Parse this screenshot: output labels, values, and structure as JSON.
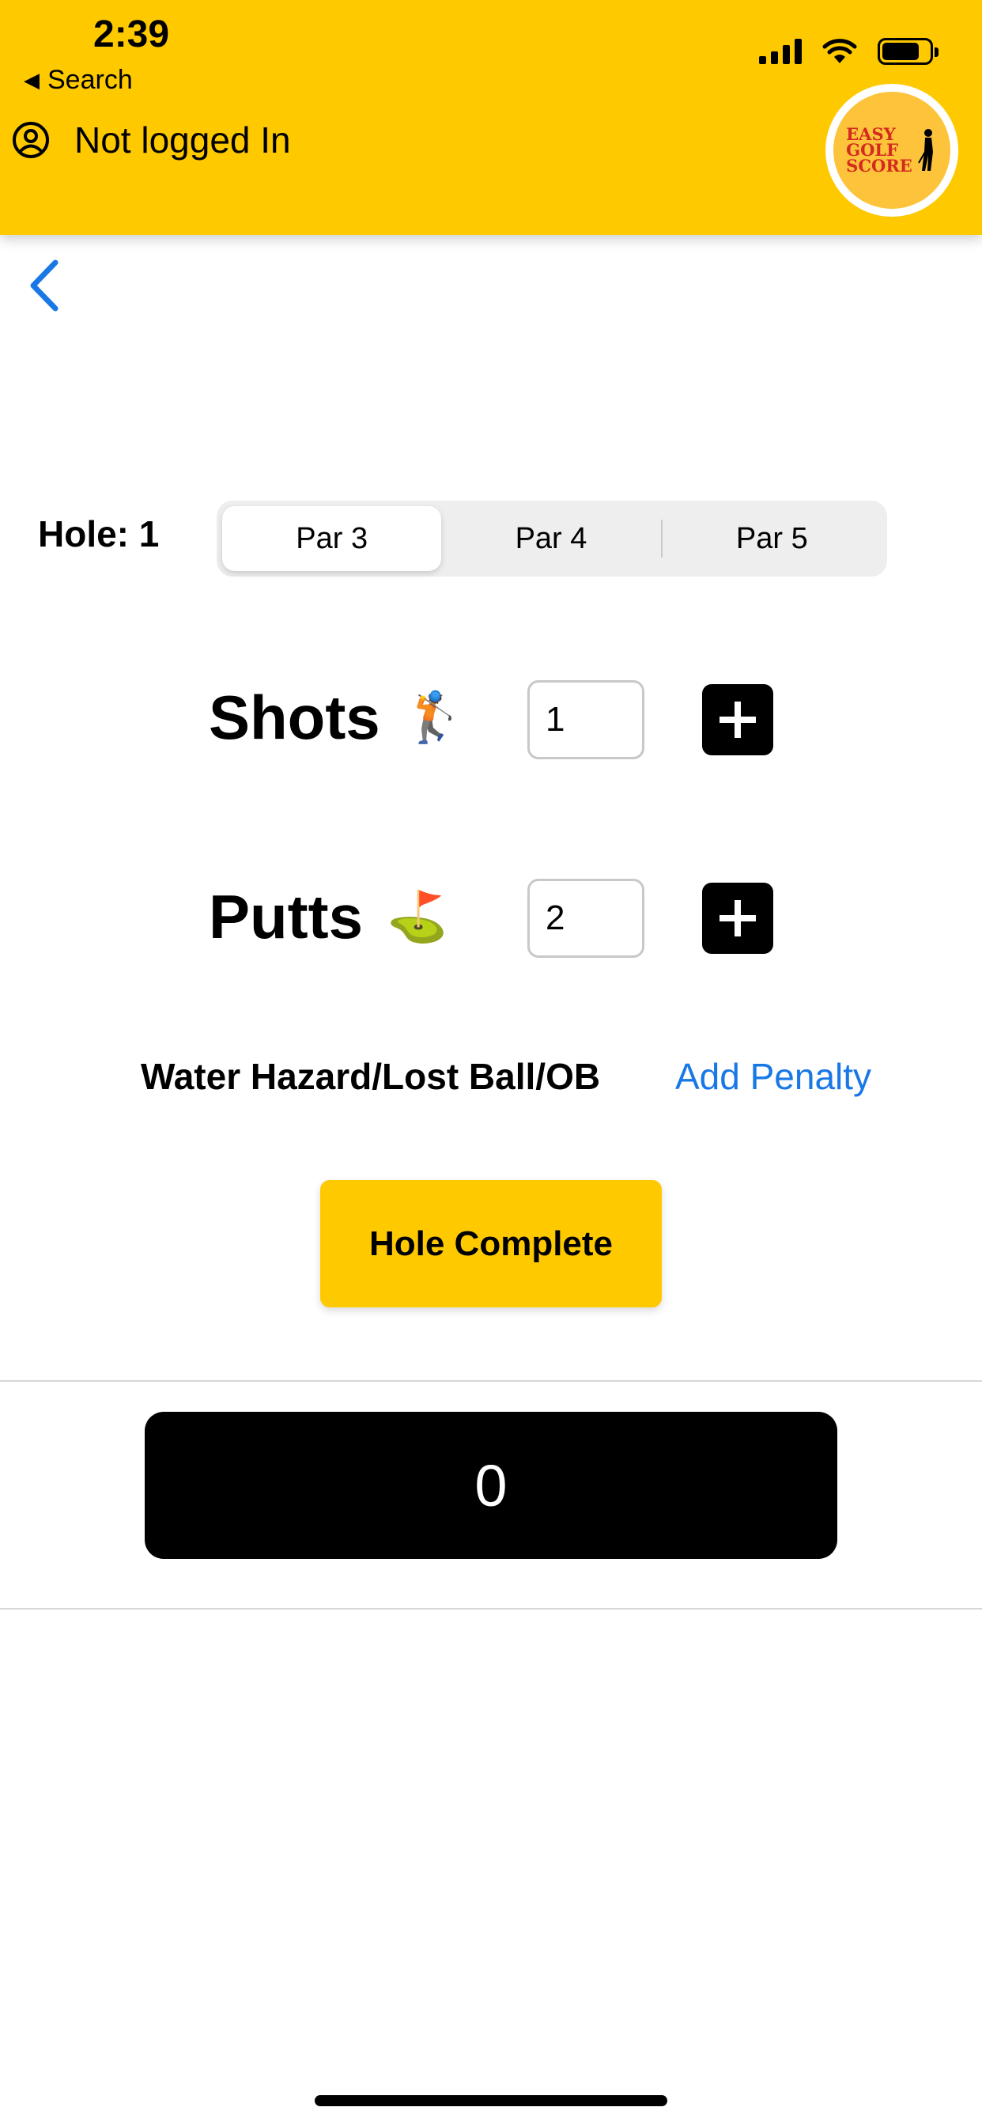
{
  "status_bar": {
    "time": "2:39",
    "back_label": "Search",
    "icons": [
      "signal-icon",
      "wifi-icon",
      "battery-icon"
    ]
  },
  "header": {
    "user_status": "Not logged In",
    "logo_text_lines": [
      "EASY",
      "GOLF",
      "SCORE"
    ],
    "background_color": "#ffc900"
  },
  "navigation": {
    "back_icon": "chevron-left-icon"
  },
  "hole": {
    "label": "Hole: 1",
    "par_options": [
      "Par 3",
      "Par 4",
      "Par 5"
    ],
    "selected_par": "Par 3"
  },
  "shots": {
    "label": "Shots",
    "emoji": "🏌️",
    "value": "1"
  },
  "putts": {
    "label": "Putts",
    "emoji": "⛳",
    "value": "2"
  },
  "penalty": {
    "label": "Water Hazard/Lost Ball/OB",
    "action": "Add Penalty",
    "link_color": "#1978e6"
  },
  "complete_button": {
    "label": "Hole Complete",
    "color": "#ffc900"
  },
  "total": {
    "value": "0"
  }
}
